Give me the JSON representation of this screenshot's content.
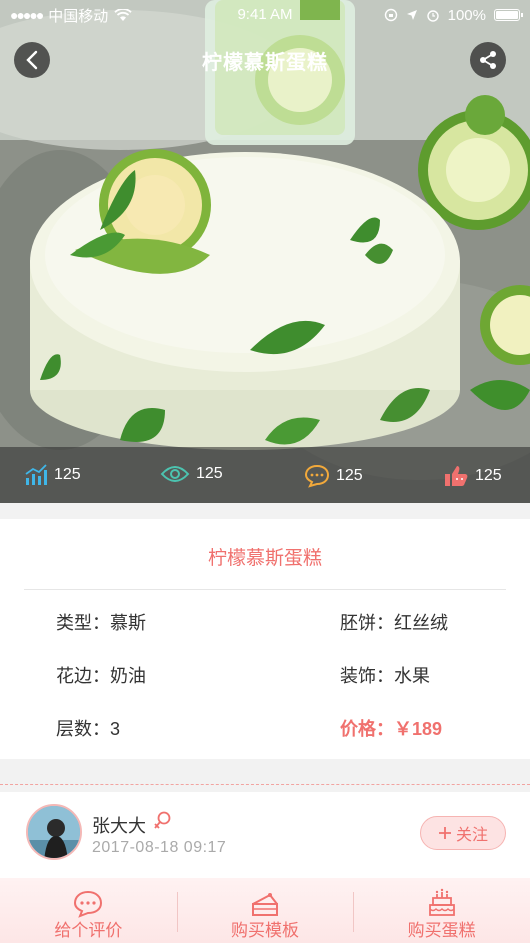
{
  "status_bar": {
    "carrier": "中国移动",
    "time": "9:41 AM",
    "battery": "100%"
  },
  "header": {
    "title": "柠檬慕斯蛋糕"
  },
  "stats": {
    "trend": "125",
    "views": "125",
    "comments": "125",
    "likes": "125"
  },
  "product": {
    "name": "柠檬慕斯蛋糕",
    "type_label": "类型：",
    "type_value": "慕斯",
    "base_label": "胚饼：",
    "base_value": "红丝绒",
    "edge_label": "花边：",
    "edge_value": "奶油",
    "deco_label": "装饰：",
    "deco_value": "水果",
    "layers_label": "层数：",
    "layers_value": "3",
    "price_label": "价格：",
    "price_value": "￥189"
  },
  "author": {
    "name": "张大大",
    "datetime": "2017-08-18  09:17",
    "follow_label": "关注"
  },
  "tabs": [
    {
      "label": "给个评价",
      "icon": "comment-icon"
    },
    {
      "label": "购买模板",
      "icon": "cake-slice-icon"
    },
    {
      "label": "购买蛋糕",
      "icon": "birthday-cake-icon"
    }
  ],
  "colors": {
    "accent": "#f0716e",
    "trend_icon": "#3fb6e8",
    "view_icon": "#4cc4b0",
    "comment_icon": "#f2a93b",
    "like_icon": "#f0716e"
  }
}
